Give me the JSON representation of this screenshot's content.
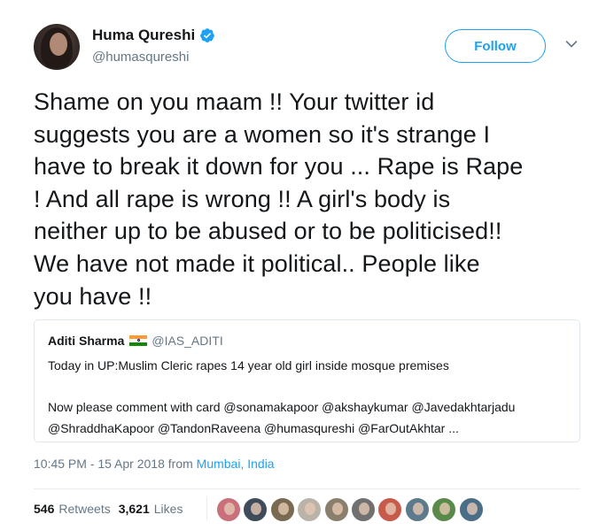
{
  "author": {
    "name": "Huma Qureshi",
    "handle": "@humasqureshi",
    "verified_icon": "verified-badge-icon"
  },
  "follow_label": "Follow",
  "tweet_lines": [
    "Shame on you maam !! Your twitter id",
    "suggests you are a women so it's strange I",
    "have to break it down for you ... Rape is Rape",
    "! And all rape is wrong !! A girl's body is",
    "neither up to be abused or to be politicised!!",
    "We have not made it political.. People like",
    "you have !!"
  ],
  "quoted": {
    "name": "Aditi Sharma",
    "flag_icon": "india-flag-icon",
    "handle": "@IAS_ADITI",
    "lines": [
      "Today in UP:Muslim Cleric rapes 14 year old girl inside mosque premises",
      "",
      "Now please comment with card @sonamakapoor @akshaykumar @Javedakhtarjadu",
      "@ShraddhaKapoor @TandonRaveena @humasqureshi @FarOutAkhtar ..."
    ]
  },
  "meta": {
    "time": "10:45 PM - 15 Apr 2018",
    "from": "from",
    "location": "Mumbai, India"
  },
  "stats": {
    "retweets_count": "546",
    "retweets_label": "Retweets",
    "likes_count": "3,621",
    "likes_label": "Likes"
  },
  "colors": {
    "accent": "#1da1f2",
    "secondary_text": "#657786",
    "primary_text": "#14171a",
    "border": "#e1e8ed"
  },
  "likers": [
    {
      "bg": "#c9707a"
    },
    {
      "bg": "#3f4a5a"
    },
    {
      "bg": "#7b6a52"
    },
    {
      "bg": "#b9b3a8"
    },
    {
      "bg": "#8a7f6c"
    },
    {
      "bg": "#707070"
    },
    {
      "bg": "#c85a4a"
    },
    {
      "bg": "#5d7a8c"
    },
    {
      "bg": "#5a8a4a"
    },
    {
      "bg": "#4a6d88"
    }
  ]
}
